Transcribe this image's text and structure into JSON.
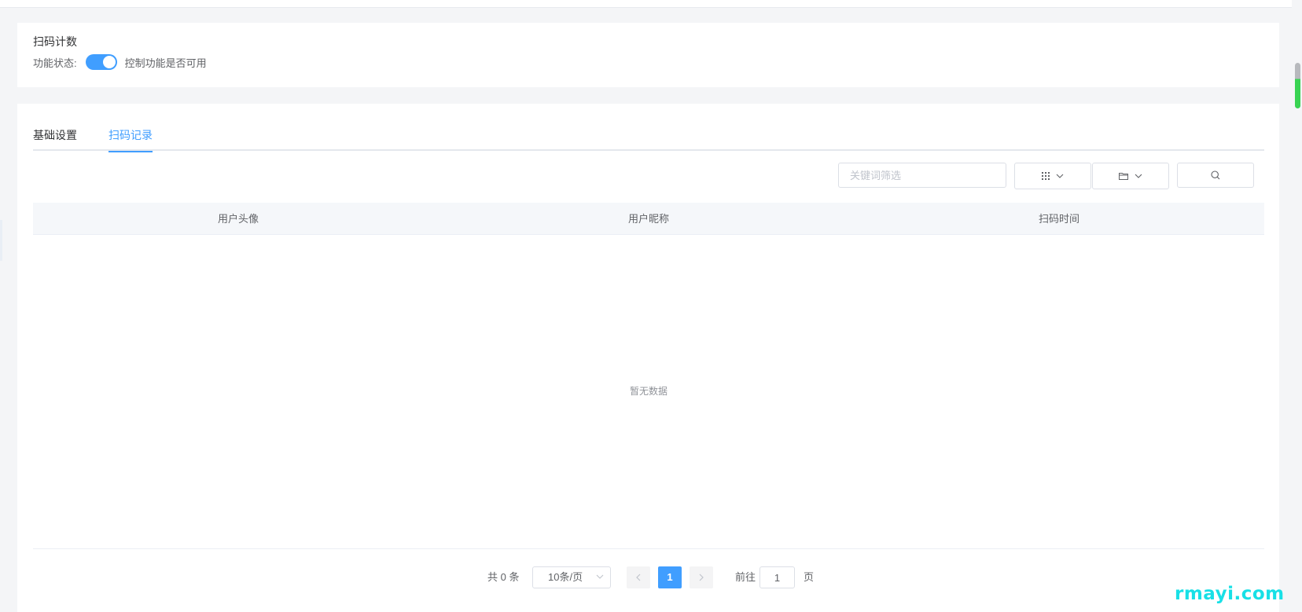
{
  "feature": {
    "title": "扫码计数",
    "status_label": "功能状态:",
    "switch_on": true,
    "status_desc": "控制功能是否可用"
  },
  "tabs": [
    {
      "label": "基础设置",
      "active": false
    },
    {
      "label": "扫码记录",
      "active": true
    }
  ],
  "toolbar": {
    "search_placeholder": "关键词筛选",
    "grid_icon": "grid-icon",
    "folder_icon": "folder-icon",
    "search_icon": "search-icon"
  },
  "table": {
    "columns": [
      "用户头像",
      "用户昵称",
      "扫码时间"
    ],
    "empty_text": "暂无数据"
  },
  "pagination": {
    "total_text": "共 0 条",
    "page_size": "10条/页",
    "current_page": "1",
    "goto_label": "前往",
    "goto_value": "1",
    "goto_suffix": "页"
  },
  "watermark": "rmayi.com",
  "colors": {
    "accent": "#409eff",
    "scroll_highlight": "#39d353",
    "watermark": "#18e0e6"
  }
}
